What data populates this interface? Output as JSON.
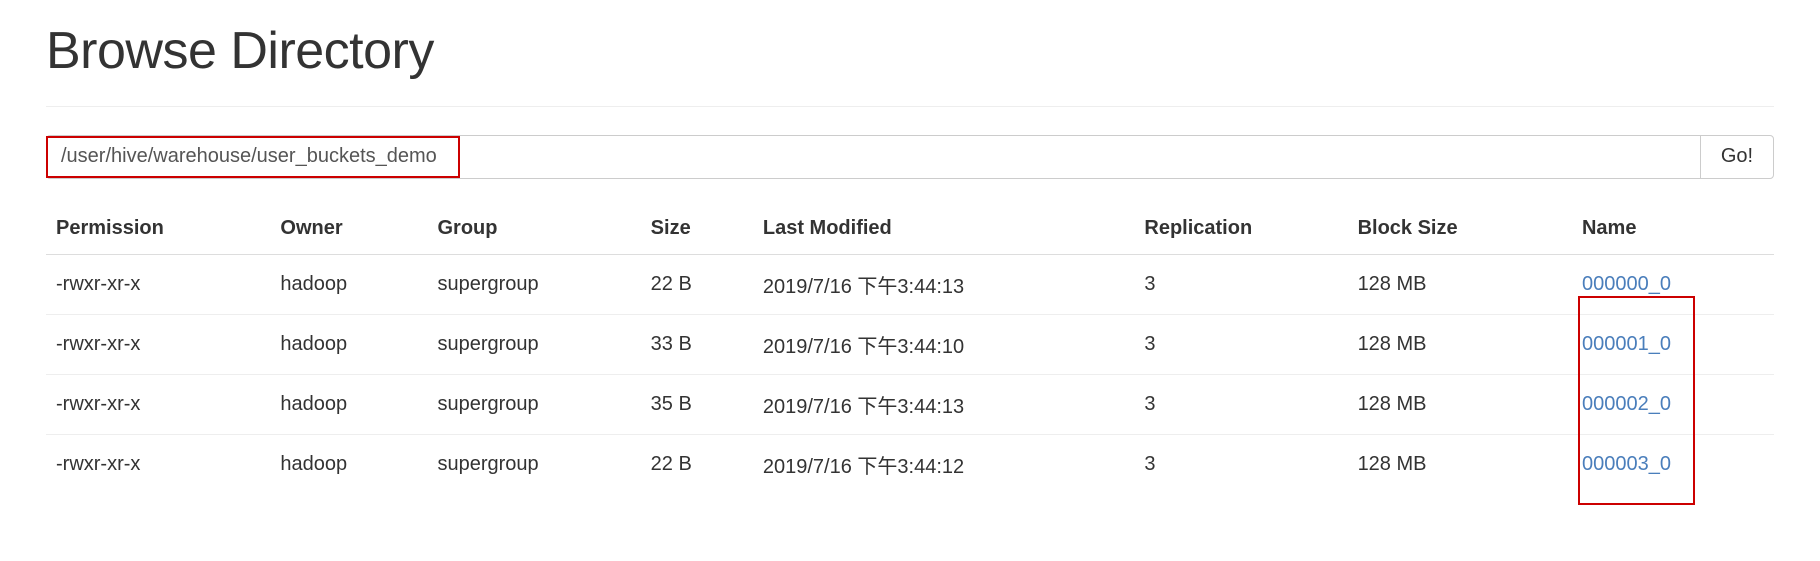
{
  "header": {
    "title": "Browse Directory"
  },
  "path_bar": {
    "value": "/user/hive/warehouse/user_buckets_demo",
    "placeholder": "",
    "go_label": "Go!"
  },
  "table": {
    "columns": [
      "Permission",
      "Owner",
      "Group",
      "Size",
      "Last Modified",
      "Replication",
      "Block Size",
      "Name"
    ],
    "rows": [
      {
        "permission": "-rwxr-xr-x",
        "owner": "hadoop",
        "group": "supergroup",
        "size": "22 B",
        "last_modified": "2019/7/16 下午3:44:13",
        "replication": "3",
        "block_size": "128 MB",
        "name": "000000_0"
      },
      {
        "permission": "-rwxr-xr-x",
        "owner": "hadoop",
        "group": "supergroup",
        "size": "33 B",
        "last_modified": "2019/7/16 下午3:44:10",
        "replication": "3",
        "block_size": "128 MB",
        "name": "000001_0"
      },
      {
        "permission": "-rwxr-xr-x",
        "owner": "hadoop",
        "group": "supergroup",
        "size": "35 B",
        "last_modified": "2019/7/16 下午3:44:13",
        "replication": "3",
        "block_size": "128 MB",
        "name": "000002_0"
      },
      {
        "permission": "-rwxr-xr-x",
        "owner": "hadoop",
        "group": "supergroup",
        "size": "22 B",
        "last_modified": "2019/7/16 下午3:44:12",
        "replication": "3",
        "block_size": "128 MB",
        "name": "000003_0"
      }
    ]
  },
  "annotations": {
    "accent_color": "#cc0000",
    "link_color": "#4a7ebb"
  }
}
